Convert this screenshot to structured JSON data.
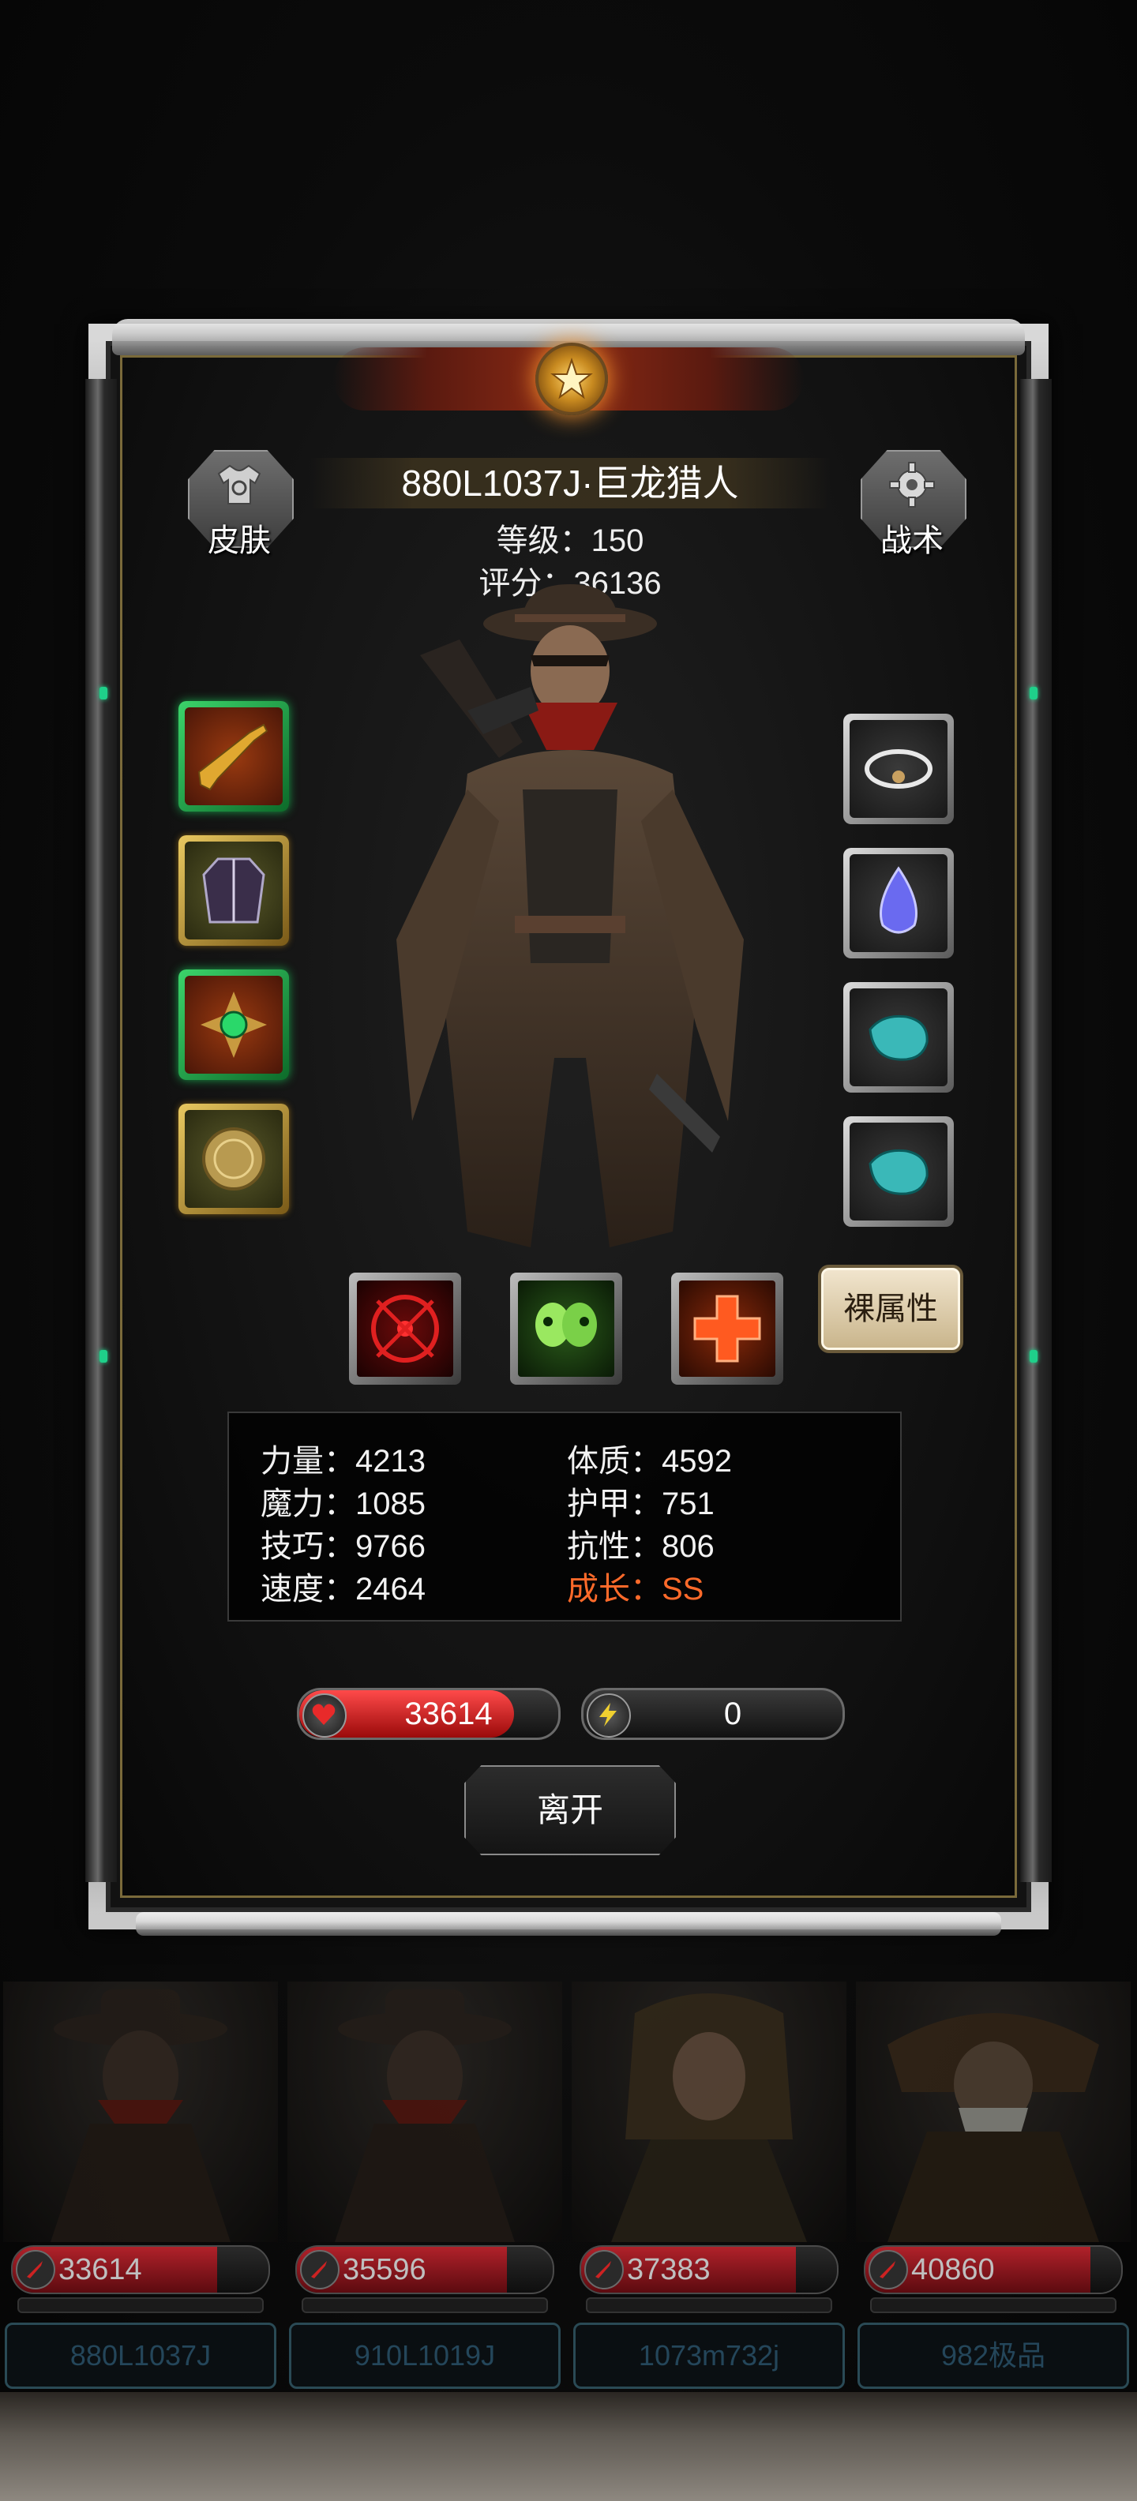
{
  "hero": {
    "name": "880L1037J·巨龙猎人",
    "level": "等级：150",
    "score": "评分：36136"
  },
  "buttons": {
    "skin": "皮肤",
    "tactic": "战术",
    "naked_attr": "裸属性",
    "leave": "离开"
  },
  "equipment_left": [
    {
      "icon": "shotgun-icon",
      "rarity": "green"
    },
    {
      "icon": "coat-icon",
      "rarity": "gold"
    },
    {
      "icon": "emerald-brooch-icon",
      "rarity": "green"
    },
    {
      "icon": "gold-medallion-icon",
      "rarity": "gold"
    }
  ],
  "equipment_right": [
    {
      "icon": "silver-ring-icon",
      "rarity": "silver"
    },
    {
      "icon": "blue-crystal-icon",
      "rarity": "silver"
    },
    {
      "icon": "teal-stone-icon",
      "rarity": "silver"
    },
    {
      "icon": "teal-stone-icon",
      "rarity": "silver"
    }
  ],
  "skills": [
    {
      "icon": "target-icon",
      "color": "#c81818"
    },
    {
      "icon": "skulls-icon",
      "color": "#3aa82a"
    },
    {
      "icon": "heal-cross-icon",
      "color": "#e84818"
    }
  ],
  "stats": {
    "strength": "力量：4213",
    "constitution": "体质：4592",
    "magic": "魔力：1085",
    "armor": "护甲：751",
    "skill": "技巧：9766",
    "resistance": "抗性：806",
    "speed": "速度：2464",
    "growth": "成长：SS"
  },
  "hp_bar": {
    "value": "33614",
    "fill": 0.83
  },
  "energy_bar": {
    "value": "0",
    "fill": 0
  },
  "colors": {
    "hp": "#e02a2a",
    "growth": "#ff6a2a",
    "frame": "#7a6a3a"
  },
  "roster": [
    {
      "hp": "33614",
      "name": "880L1037J",
      "fill": 0.8
    },
    {
      "hp": "35596",
      "name": "910L1019J",
      "fill": 0.82
    },
    {
      "hp": "37383",
      "name": "1073m732j",
      "fill": 0.84
    },
    {
      "hp": "40860",
      "name": "982极品",
      "fill": 0.88
    }
  ]
}
